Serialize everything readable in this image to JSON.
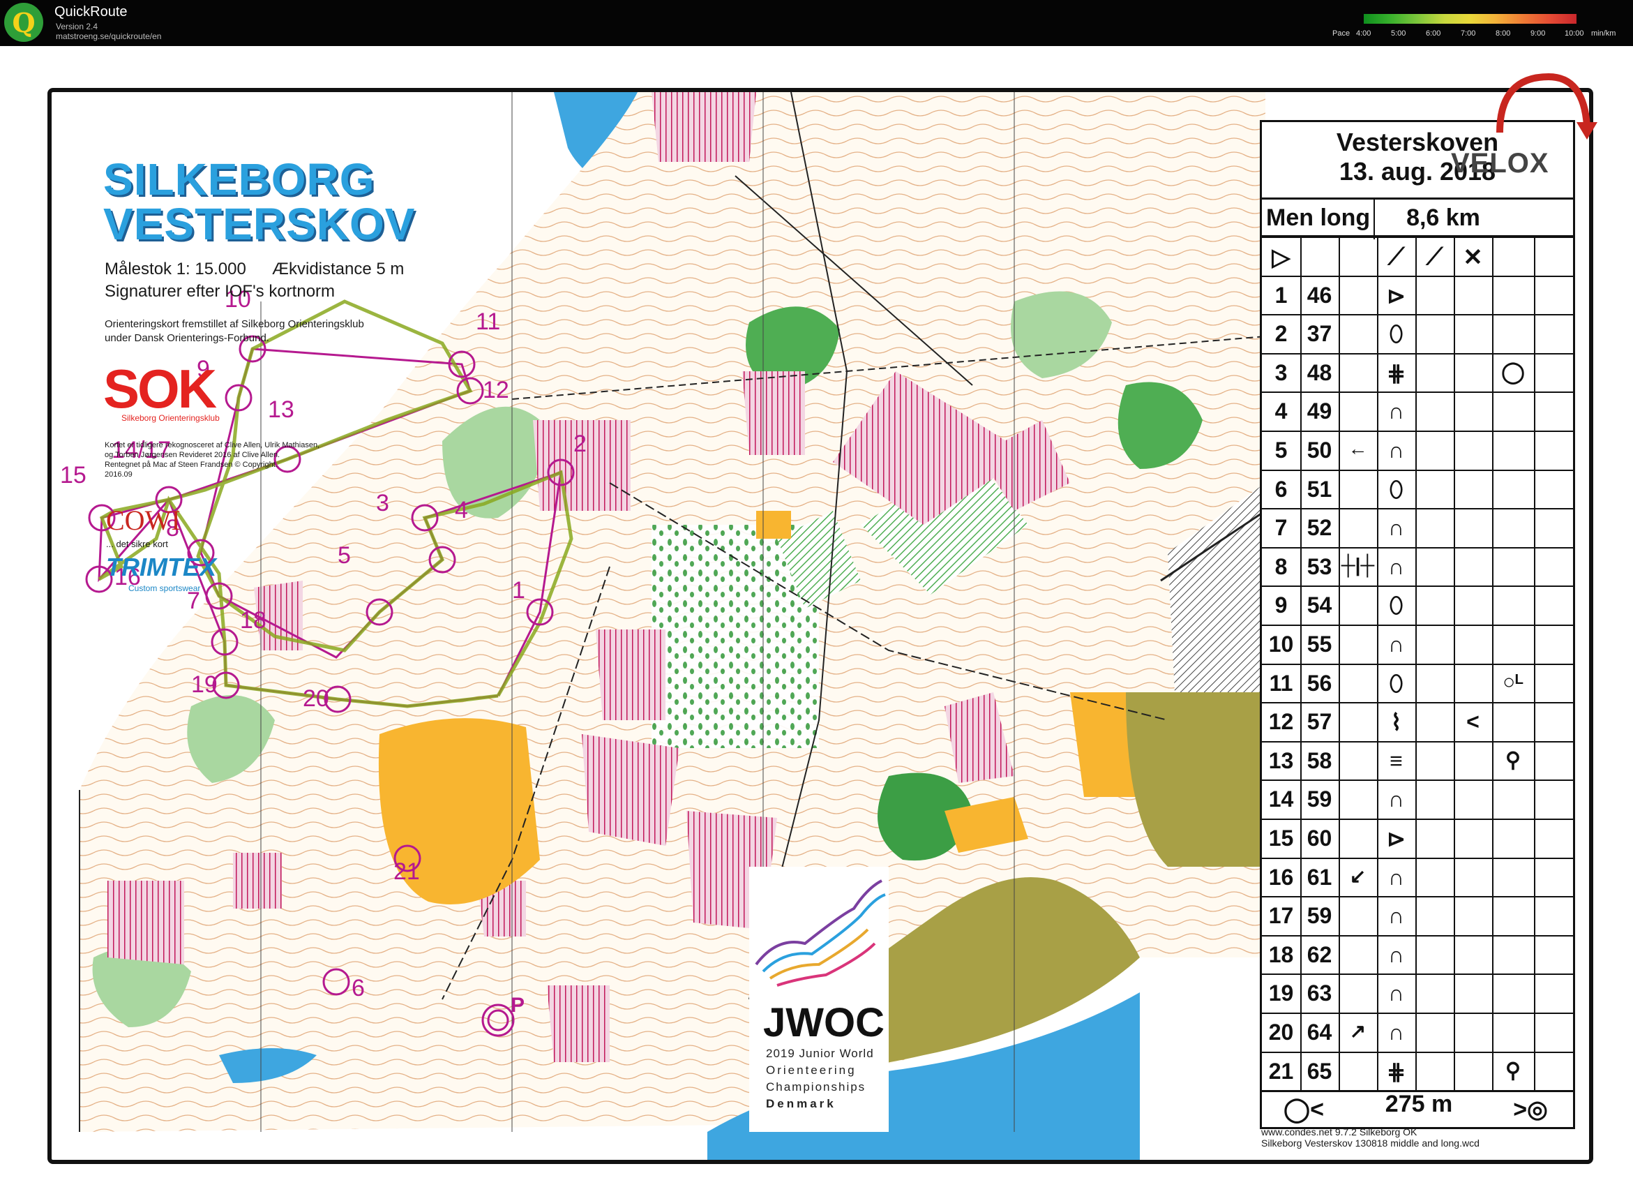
{
  "app": {
    "title": "QuickRoute",
    "version": "Version 2.4",
    "url": "matstroeng.se/quickroute/en",
    "logo_letter": "Q"
  },
  "pace_scale": {
    "label": "Pace",
    "ticks": [
      "4:00",
      "5:00",
      "6:00",
      "7:00",
      "8:00",
      "9:00",
      "10:00"
    ],
    "unit": "min/km",
    "colors": [
      "#0f8f1e",
      "#7cc63b",
      "#e9d83a",
      "#ef7b35",
      "#c9272c"
    ]
  },
  "map": {
    "title_line1": "SILKEBORG",
    "title_line2": "VESTERSKOV",
    "scale": "Målestok 1: 15.000",
    "contour": "Ækvidistance 5 m",
    "symbols": "Signaturer efter IOF's kortnorm",
    "made_by_1": "Orienteringskort fremstillet af Silkeborg Orienteringsklub",
    "made_by_2": "under Dansk Orienterings-Forbund.",
    "sok_logo": "SOK",
    "sok_sub": "Silkeborg Orienteringsklub",
    "credits_1": "Kortet er tidligere rekognosceret af Clive Allen, Ulrik Mathiasen,",
    "credits_2": "og Torben Jørgensen  Revideret 2016 af Clive Allen.",
    "credits_3": "Rentegnet på Mac af Steen Frandsen   © Copyright.",
    "credits_4": "2016.09",
    "cowi_logo": "COWI",
    "cowi_sub": "... det sikre kort",
    "trimtex_logo": "TRIMTEX",
    "trimtex_sub": "Custom sportswear",
    "jwoc_logo": "JWOC",
    "jwoc_line1": "2019 Junior World",
    "jwoc_line2": "Orienteering",
    "jwoc_line3": "Championships",
    "jwoc_line4": "Denmark",
    "software_1": "www.condes.net 9.7.2 Silkeborg OK",
    "software_2": "Silkeborg Vesterskov 130818 middle and long.wcd",
    "colors": {
      "course": "#b5198f",
      "water": "#3ea6e0",
      "open_land": "#f8b530",
      "green": "#2f9a3a",
      "olive": "#a8a046",
      "contour": "#c27b3a"
    }
  },
  "course": {
    "start_label": "",
    "finish_label": "P",
    "controls": [
      {
        "label": "1"
      },
      {
        "label": "2"
      },
      {
        "label": "3"
      },
      {
        "label": "4"
      },
      {
        "label": "5"
      },
      {
        "label": "6"
      },
      {
        "label": "7"
      },
      {
        "label": "8"
      },
      {
        "label": "9"
      },
      {
        "label": "10"
      },
      {
        "label": "11"
      },
      {
        "label": "12"
      },
      {
        "label": "13"
      },
      {
        "label": "14/17"
      },
      {
        "label": "15"
      },
      {
        "label": "16"
      },
      {
        "label": "18"
      },
      {
        "label": "19"
      },
      {
        "label": "20"
      },
      {
        "label": "21"
      }
    ]
  },
  "description_sheet": {
    "event": "Vesterskoven",
    "date": "13. aug. 2018",
    "class": "Men long",
    "length": "8,6 km",
    "rows": [
      {
        "num": "1",
        "code": "46",
        "symbol": "⊳"
      },
      {
        "num": "2",
        "code": "37",
        "symbol": "⬯"
      },
      {
        "num": "3",
        "code": "48",
        "symbol": "⋕",
        "extra": "◯"
      },
      {
        "num": "4",
        "code": "49",
        "symbol": "∩"
      },
      {
        "num": "5",
        "code": "50",
        "pre": "←",
        "symbol": "∩"
      },
      {
        "num": "6",
        "code": "51",
        "symbol": "⬯"
      },
      {
        "num": "7",
        "code": "52",
        "symbol": "∩"
      },
      {
        "num": "8",
        "code": "53",
        "pre": "┼|┼",
        "symbol": "∩"
      },
      {
        "num": "9",
        "code": "54",
        "symbol": "⬯"
      },
      {
        "num": "10",
        "code": "55",
        "symbol": "∩"
      },
      {
        "num": "11",
        "code": "56",
        "symbol": "⬯",
        "extra": "○ᴸ"
      },
      {
        "num": "12",
        "code": "57",
        "symbol": "⌇",
        "col6": "<"
      },
      {
        "num": "13",
        "code": "58",
        "symbol": "≡",
        "extra": "⚲"
      },
      {
        "num": "14",
        "code": "59",
        "symbol": "∩"
      },
      {
        "num": "15",
        "code": "60",
        "symbol": "⊳"
      },
      {
        "num": "16",
        "code": "61",
        "pre": "↙",
        "symbol": "∩"
      },
      {
        "num": "17",
        "code": "59",
        "symbol": "∩"
      },
      {
        "num": "18",
        "code": "62",
        "symbol": "∩"
      },
      {
        "num": "19",
        "code": "63",
        "symbol": "∩"
      },
      {
        "num": "20",
        "code": "64",
        "pre": "↗",
        "symbol": "∩"
      },
      {
        "num": "21",
        "code": "65",
        "symbol": "⋕",
        "extra": "⚲"
      }
    ],
    "finish_text": "275 m"
  },
  "velox_logo": "VELOX"
}
